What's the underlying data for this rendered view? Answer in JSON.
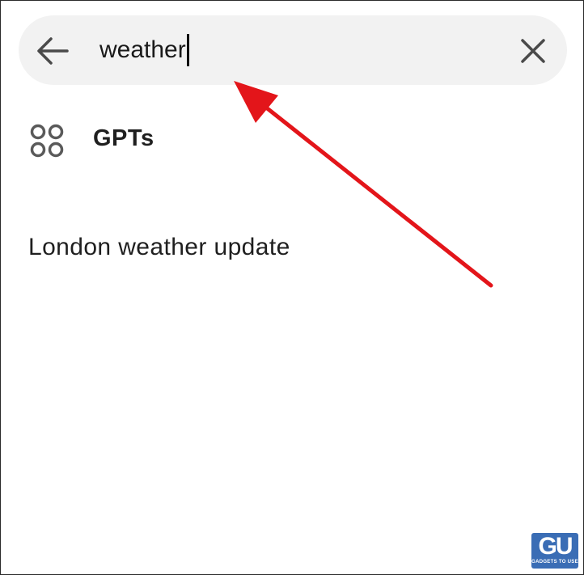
{
  "search": {
    "query": "weather",
    "back_icon": "arrow-left-icon",
    "clear_icon": "close-icon"
  },
  "results": {
    "gpts": {
      "label": "GPTs",
      "icon": "grid-circles-icon"
    },
    "suggestions": [
      {
        "text": "London weather update"
      }
    ]
  },
  "annotation": {
    "arrow_color": "#e3151a"
  },
  "watermark": {
    "logo": "GU",
    "text": "GADGETS TO USE"
  }
}
